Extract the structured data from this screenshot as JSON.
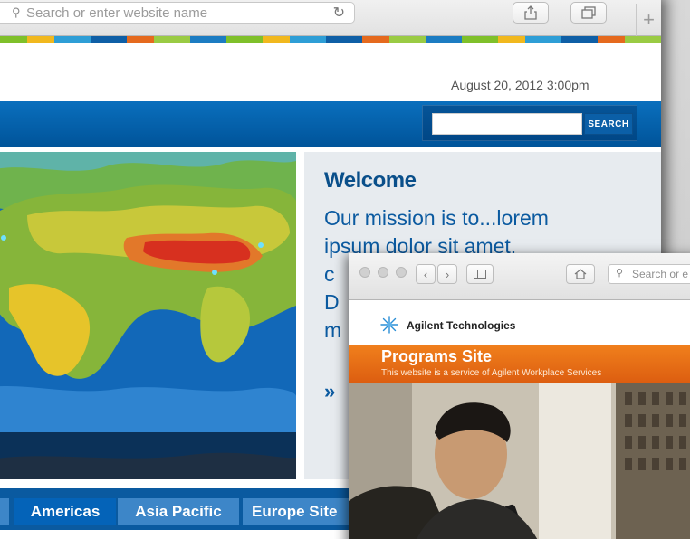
{
  "back_window": {
    "url_placeholder": "Search or enter website name",
    "date_time": "August 20, 2012   3:00pm",
    "search_button_label": "SEARCH",
    "welcome_title": "Welcome",
    "mission_line1": "Our mission is to...lorem",
    "mission_line2": "ipsum dolor sit amet,",
    "mission_line3": "c",
    "mission_line4": "D",
    "mission_line5": "m",
    "more_link": "»",
    "nav_tabs": [
      {
        "label": "Americas"
      },
      {
        "label": "Asia Pacific"
      },
      {
        "label": "Europe Site"
      }
    ],
    "colors": {
      "brand_blue": "#0a5aa0",
      "heading_blue": "#0a4f8a"
    }
  },
  "front_window": {
    "url_placeholder": "Search or e",
    "company_name": "Agilent Technologies",
    "site_title": "Programs Site",
    "site_subtitle": "This website is a service of Agilent Workplace Services",
    "colors": {
      "orange": "#e8701a"
    }
  }
}
